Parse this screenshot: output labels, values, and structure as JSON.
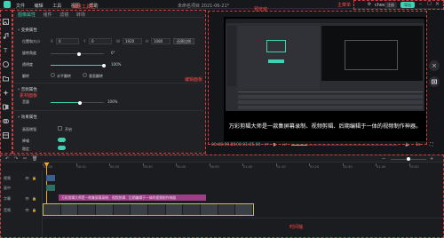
{
  "menubar": {
    "items": [
      "文件",
      "编辑",
      "工具",
      "视图",
      "帮助"
    ],
    "title": "未命名项目 2021-06-21*",
    "search_label": "搜索",
    "login_label": "cheer",
    "register_label": "注册",
    "export_label": "导出"
  },
  "annotations": {
    "attribute_toolbar": "属性工具栏",
    "preview_window": "预览窗",
    "main_toolbar": "主菜单",
    "media_library": "素材面板",
    "edit_panel": "编辑面板",
    "timeline": "时间轴",
    "property_text": "属性工具栏"
  },
  "props": {
    "tabs": [
      "图像属性",
      "组件",
      "滤镜",
      "转场"
    ],
    "section_transform": "变换属性",
    "pos_label": "位置和大小",
    "x_label": "X",
    "x_value": "0",
    "y_label": "Y",
    "y_value": "0",
    "w_label": "W",
    "w_value": "1920",
    "h_label": "H",
    "h_value": "1080",
    "reset_btn": "还原比例",
    "rotate_label": "旋转角度",
    "rotate_value": "0°",
    "opacity_label": "透明度",
    "opacity_value": "100%",
    "opacity_fraction": 1.0,
    "flip_label": "翻转",
    "flip_h": "水平翻转",
    "flip_v": "垂直翻转",
    "section_audio": "音频属性",
    "volume_label": "音量",
    "volume_value": "100%",
    "volume_fraction": 0.55,
    "section_effects": "效果属性",
    "effect_label": "画面增强",
    "effect_value": "开启",
    "effect2_label": "降噪",
    "effect3_label": "稳定"
  },
  "preview": {
    "caption": "万彩剪辑大师是一款集屏幕录制、视频剪辑、后期编辑于一体的视频制作神器。",
    "time_current": "00:00:09.80",
    "time_total": "00:01:05.00",
    "speed_label": "1x"
  },
  "timeline": {
    "tracks": [
      "视频",
      "画中",
      "字幕",
      "音频"
    ],
    "ruler": [
      "00:00",
      "00:10",
      "00:20",
      "00:30",
      "00:40",
      "00:50",
      "01:00",
      "01:10",
      "01:20",
      "01:30",
      "01:40",
      "01:50"
    ],
    "subtitle_clip_text": "万彩剪辑大师是一款集屏幕录制、视频剪辑、后期编辑于一体的视频制作神器"
  },
  "colors": {
    "accent": "#3fd1b3",
    "annotation": "#d63c3c",
    "subtitle_clip": "#9b3f86",
    "video_clip_border": "#c7c23a"
  }
}
